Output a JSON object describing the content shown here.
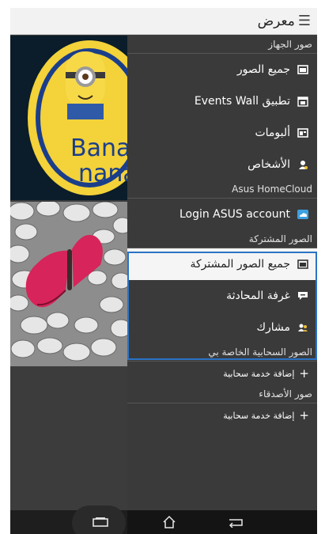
{
  "app": {
    "title": "معرض",
    "menu_glyph": "☰"
  },
  "drawer": {
    "device_section": {
      "label": "صور الجهاز",
      "items": [
        {
          "label": "جميع الصور",
          "icon": "photos-icon"
        },
        {
          "label": "تطبيق Events Wall",
          "icon": "events-wall-icon"
        },
        {
          "label": "ألبومات",
          "icon": "albums-icon"
        },
        {
          "label": "الأشخاص",
          "icon": "person-icon"
        }
      ]
    },
    "cloud_section": {
      "label": "Asus HomeCloud",
      "items": [
        {
          "label": "Login ASUS account",
          "icon": "cloud-icon"
        }
      ]
    },
    "shared_section": {
      "label": "الصور المشتركة",
      "items": [
        {
          "label": "جميع الصور المشتركة",
          "icon": "photos-icon",
          "selected": true
        },
        {
          "label": "غرفة المحادثة",
          "icon": "chat-icon"
        },
        {
          "label": "مشارك",
          "icon": "people-icon"
        }
      ]
    },
    "my_cloud_section": {
      "label": "الصور السحابية الخاصة بي",
      "items": [
        {
          "label": "إضافة خدمة سحابية",
          "icon": "plus-icon"
        }
      ]
    },
    "friends_section": {
      "label": "صور الأصدقاء",
      "items": [
        {
          "label": "إضافة خدمة سحابية",
          "icon": "plus-icon"
        }
      ]
    }
  },
  "thumbnails": [
    {
      "name": "minion-banana-logo",
      "lines": [
        "Banana",
        "nana"
      ]
    },
    {
      "name": "butterfly-on-pebbles"
    }
  ],
  "navbar": {
    "buttons": [
      "recent-apps-icon",
      "home-icon",
      "back-icon"
    ]
  },
  "colors": {
    "drawer_bg": "#3a3a3a",
    "selection_border": "#2a73c6",
    "highlight_bg": "#f5f5f5",
    "logo_yellow": "#f3d23a"
  }
}
